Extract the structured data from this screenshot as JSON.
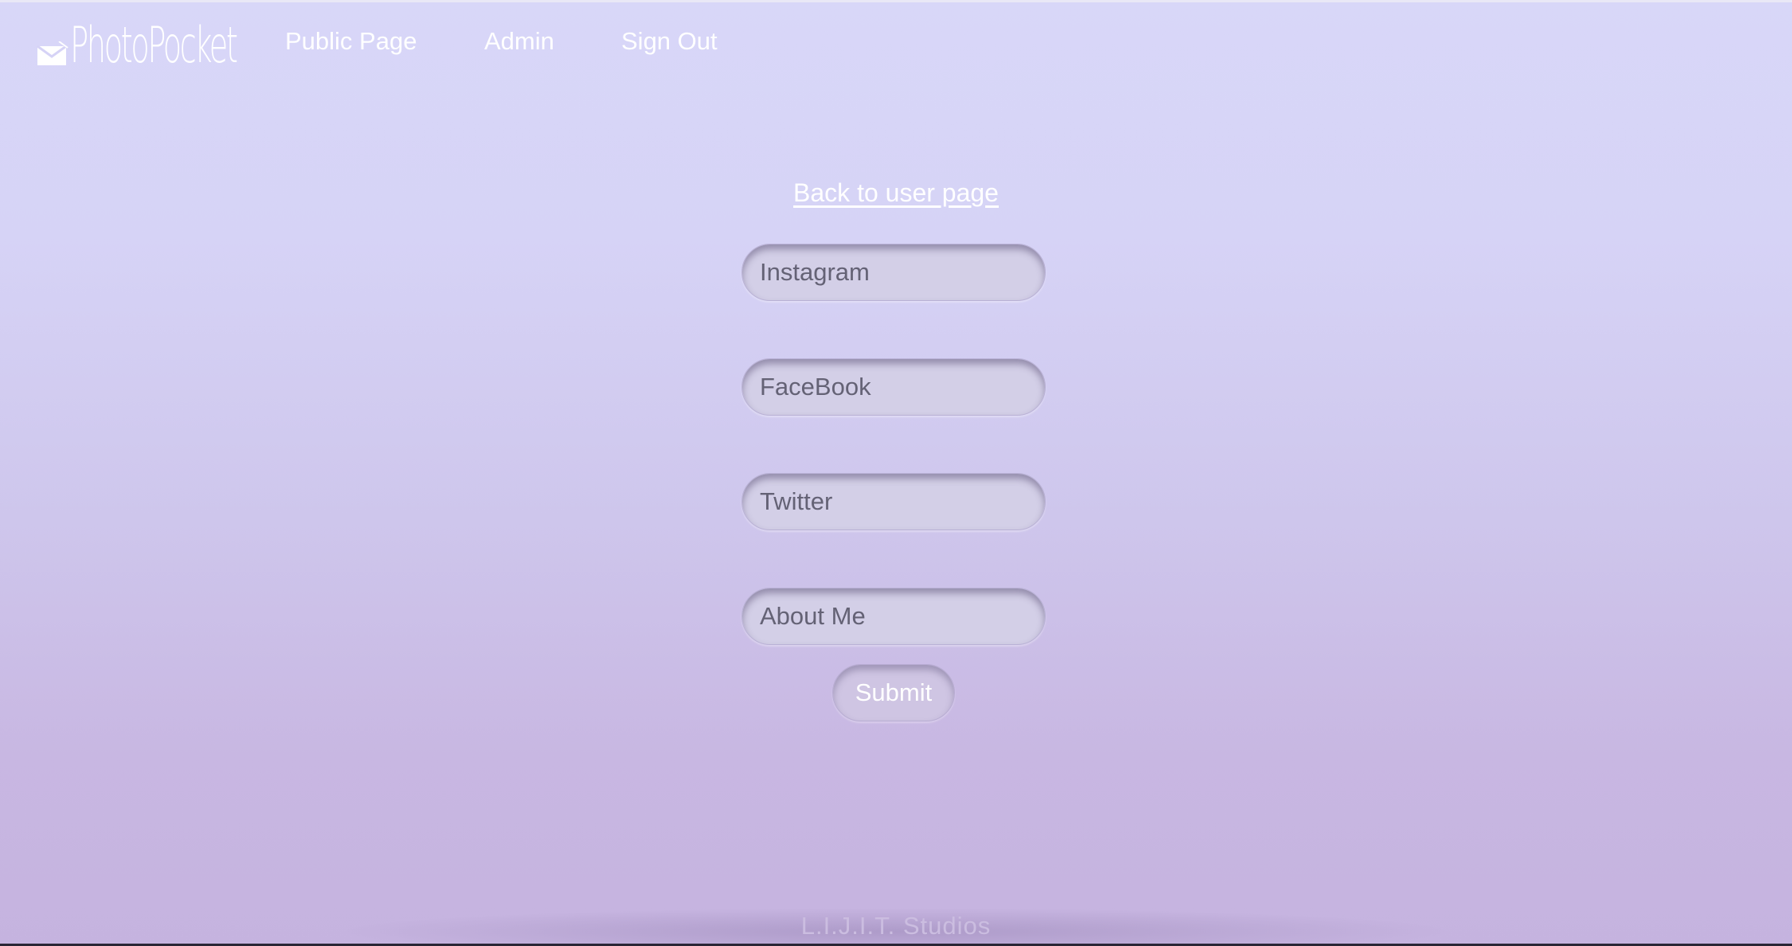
{
  "brand": {
    "name": "PhotoPocket",
    "icon": "envelope-icon"
  },
  "nav": {
    "items": [
      {
        "label": "Public Page"
      },
      {
        "label": "Admin"
      },
      {
        "label": "Sign Out"
      }
    ]
  },
  "main": {
    "back_link": "Back to user page",
    "fields": [
      {
        "placeholder": "Instagram",
        "value": ""
      },
      {
        "placeholder": "FaceBook",
        "value": ""
      },
      {
        "placeholder": "Twitter",
        "value": ""
      },
      {
        "placeholder": "About Me",
        "value": ""
      }
    ],
    "submit_label": "Submit"
  },
  "footer": {
    "text": "L.I.J.I.T. Studios"
  },
  "colors": {
    "background_top": "#d8d7f8",
    "background_bottom": "#c5b3df",
    "text_light": "#ffffff",
    "input_fill": "#d3cfe7"
  }
}
